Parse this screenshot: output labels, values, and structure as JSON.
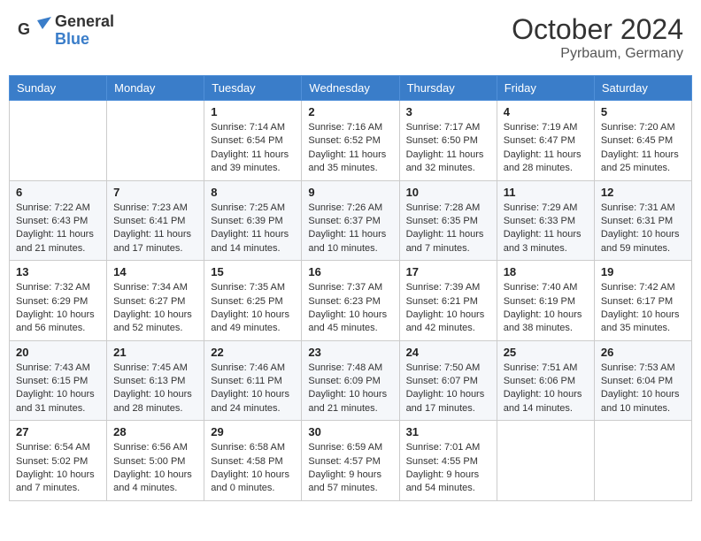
{
  "header": {
    "logo_line1": "General",
    "logo_line2": "Blue",
    "month_year": "October 2024",
    "location": "Pyrbaum, Germany"
  },
  "weekdays": [
    "Sunday",
    "Monday",
    "Tuesday",
    "Wednesday",
    "Thursday",
    "Friday",
    "Saturday"
  ],
  "weeks": [
    [
      {
        "day": "",
        "info": ""
      },
      {
        "day": "",
        "info": ""
      },
      {
        "day": "1",
        "info": "Sunrise: 7:14 AM\nSunset: 6:54 PM\nDaylight: 11 hours\nand 39 minutes."
      },
      {
        "day": "2",
        "info": "Sunrise: 7:16 AM\nSunset: 6:52 PM\nDaylight: 11 hours\nand 35 minutes."
      },
      {
        "day": "3",
        "info": "Sunrise: 7:17 AM\nSunset: 6:50 PM\nDaylight: 11 hours\nand 32 minutes."
      },
      {
        "day": "4",
        "info": "Sunrise: 7:19 AM\nSunset: 6:47 PM\nDaylight: 11 hours\nand 28 minutes."
      },
      {
        "day": "5",
        "info": "Sunrise: 7:20 AM\nSunset: 6:45 PM\nDaylight: 11 hours\nand 25 minutes."
      }
    ],
    [
      {
        "day": "6",
        "info": "Sunrise: 7:22 AM\nSunset: 6:43 PM\nDaylight: 11 hours\nand 21 minutes."
      },
      {
        "day": "7",
        "info": "Sunrise: 7:23 AM\nSunset: 6:41 PM\nDaylight: 11 hours\nand 17 minutes."
      },
      {
        "day": "8",
        "info": "Sunrise: 7:25 AM\nSunset: 6:39 PM\nDaylight: 11 hours\nand 14 minutes."
      },
      {
        "day": "9",
        "info": "Sunrise: 7:26 AM\nSunset: 6:37 PM\nDaylight: 11 hours\nand 10 minutes."
      },
      {
        "day": "10",
        "info": "Sunrise: 7:28 AM\nSunset: 6:35 PM\nDaylight: 11 hours\nand 7 minutes."
      },
      {
        "day": "11",
        "info": "Sunrise: 7:29 AM\nSunset: 6:33 PM\nDaylight: 11 hours\nand 3 minutes."
      },
      {
        "day": "12",
        "info": "Sunrise: 7:31 AM\nSunset: 6:31 PM\nDaylight: 10 hours\nand 59 minutes."
      }
    ],
    [
      {
        "day": "13",
        "info": "Sunrise: 7:32 AM\nSunset: 6:29 PM\nDaylight: 10 hours\nand 56 minutes."
      },
      {
        "day": "14",
        "info": "Sunrise: 7:34 AM\nSunset: 6:27 PM\nDaylight: 10 hours\nand 52 minutes."
      },
      {
        "day": "15",
        "info": "Sunrise: 7:35 AM\nSunset: 6:25 PM\nDaylight: 10 hours\nand 49 minutes."
      },
      {
        "day": "16",
        "info": "Sunrise: 7:37 AM\nSunset: 6:23 PM\nDaylight: 10 hours\nand 45 minutes."
      },
      {
        "day": "17",
        "info": "Sunrise: 7:39 AM\nSunset: 6:21 PM\nDaylight: 10 hours\nand 42 minutes."
      },
      {
        "day": "18",
        "info": "Sunrise: 7:40 AM\nSunset: 6:19 PM\nDaylight: 10 hours\nand 38 minutes."
      },
      {
        "day": "19",
        "info": "Sunrise: 7:42 AM\nSunset: 6:17 PM\nDaylight: 10 hours\nand 35 minutes."
      }
    ],
    [
      {
        "day": "20",
        "info": "Sunrise: 7:43 AM\nSunset: 6:15 PM\nDaylight: 10 hours\nand 31 minutes."
      },
      {
        "day": "21",
        "info": "Sunrise: 7:45 AM\nSunset: 6:13 PM\nDaylight: 10 hours\nand 28 minutes."
      },
      {
        "day": "22",
        "info": "Sunrise: 7:46 AM\nSunset: 6:11 PM\nDaylight: 10 hours\nand 24 minutes."
      },
      {
        "day": "23",
        "info": "Sunrise: 7:48 AM\nSunset: 6:09 PM\nDaylight: 10 hours\nand 21 minutes."
      },
      {
        "day": "24",
        "info": "Sunrise: 7:50 AM\nSunset: 6:07 PM\nDaylight: 10 hours\nand 17 minutes."
      },
      {
        "day": "25",
        "info": "Sunrise: 7:51 AM\nSunset: 6:06 PM\nDaylight: 10 hours\nand 14 minutes."
      },
      {
        "day": "26",
        "info": "Sunrise: 7:53 AM\nSunset: 6:04 PM\nDaylight: 10 hours\nand 10 minutes."
      }
    ],
    [
      {
        "day": "27",
        "info": "Sunrise: 6:54 AM\nSunset: 5:02 PM\nDaylight: 10 hours\nand 7 minutes."
      },
      {
        "day": "28",
        "info": "Sunrise: 6:56 AM\nSunset: 5:00 PM\nDaylight: 10 hours\nand 4 minutes."
      },
      {
        "day": "29",
        "info": "Sunrise: 6:58 AM\nSunset: 4:58 PM\nDaylight: 10 hours\nand 0 minutes."
      },
      {
        "day": "30",
        "info": "Sunrise: 6:59 AM\nSunset: 4:57 PM\nDaylight: 9 hours\nand 57 minutes."
      },
      {
        "day": "31",
        "info": "Sunrise: 7:01 AM\nSunset: 4:55 PM\nDaylight: 9 hours\nand 54 minutes."
      },
      {
        "day": "",
        "info": ""
      },
      {
        "day": "",
        "info": ""
      }
    ]
  ]
}
